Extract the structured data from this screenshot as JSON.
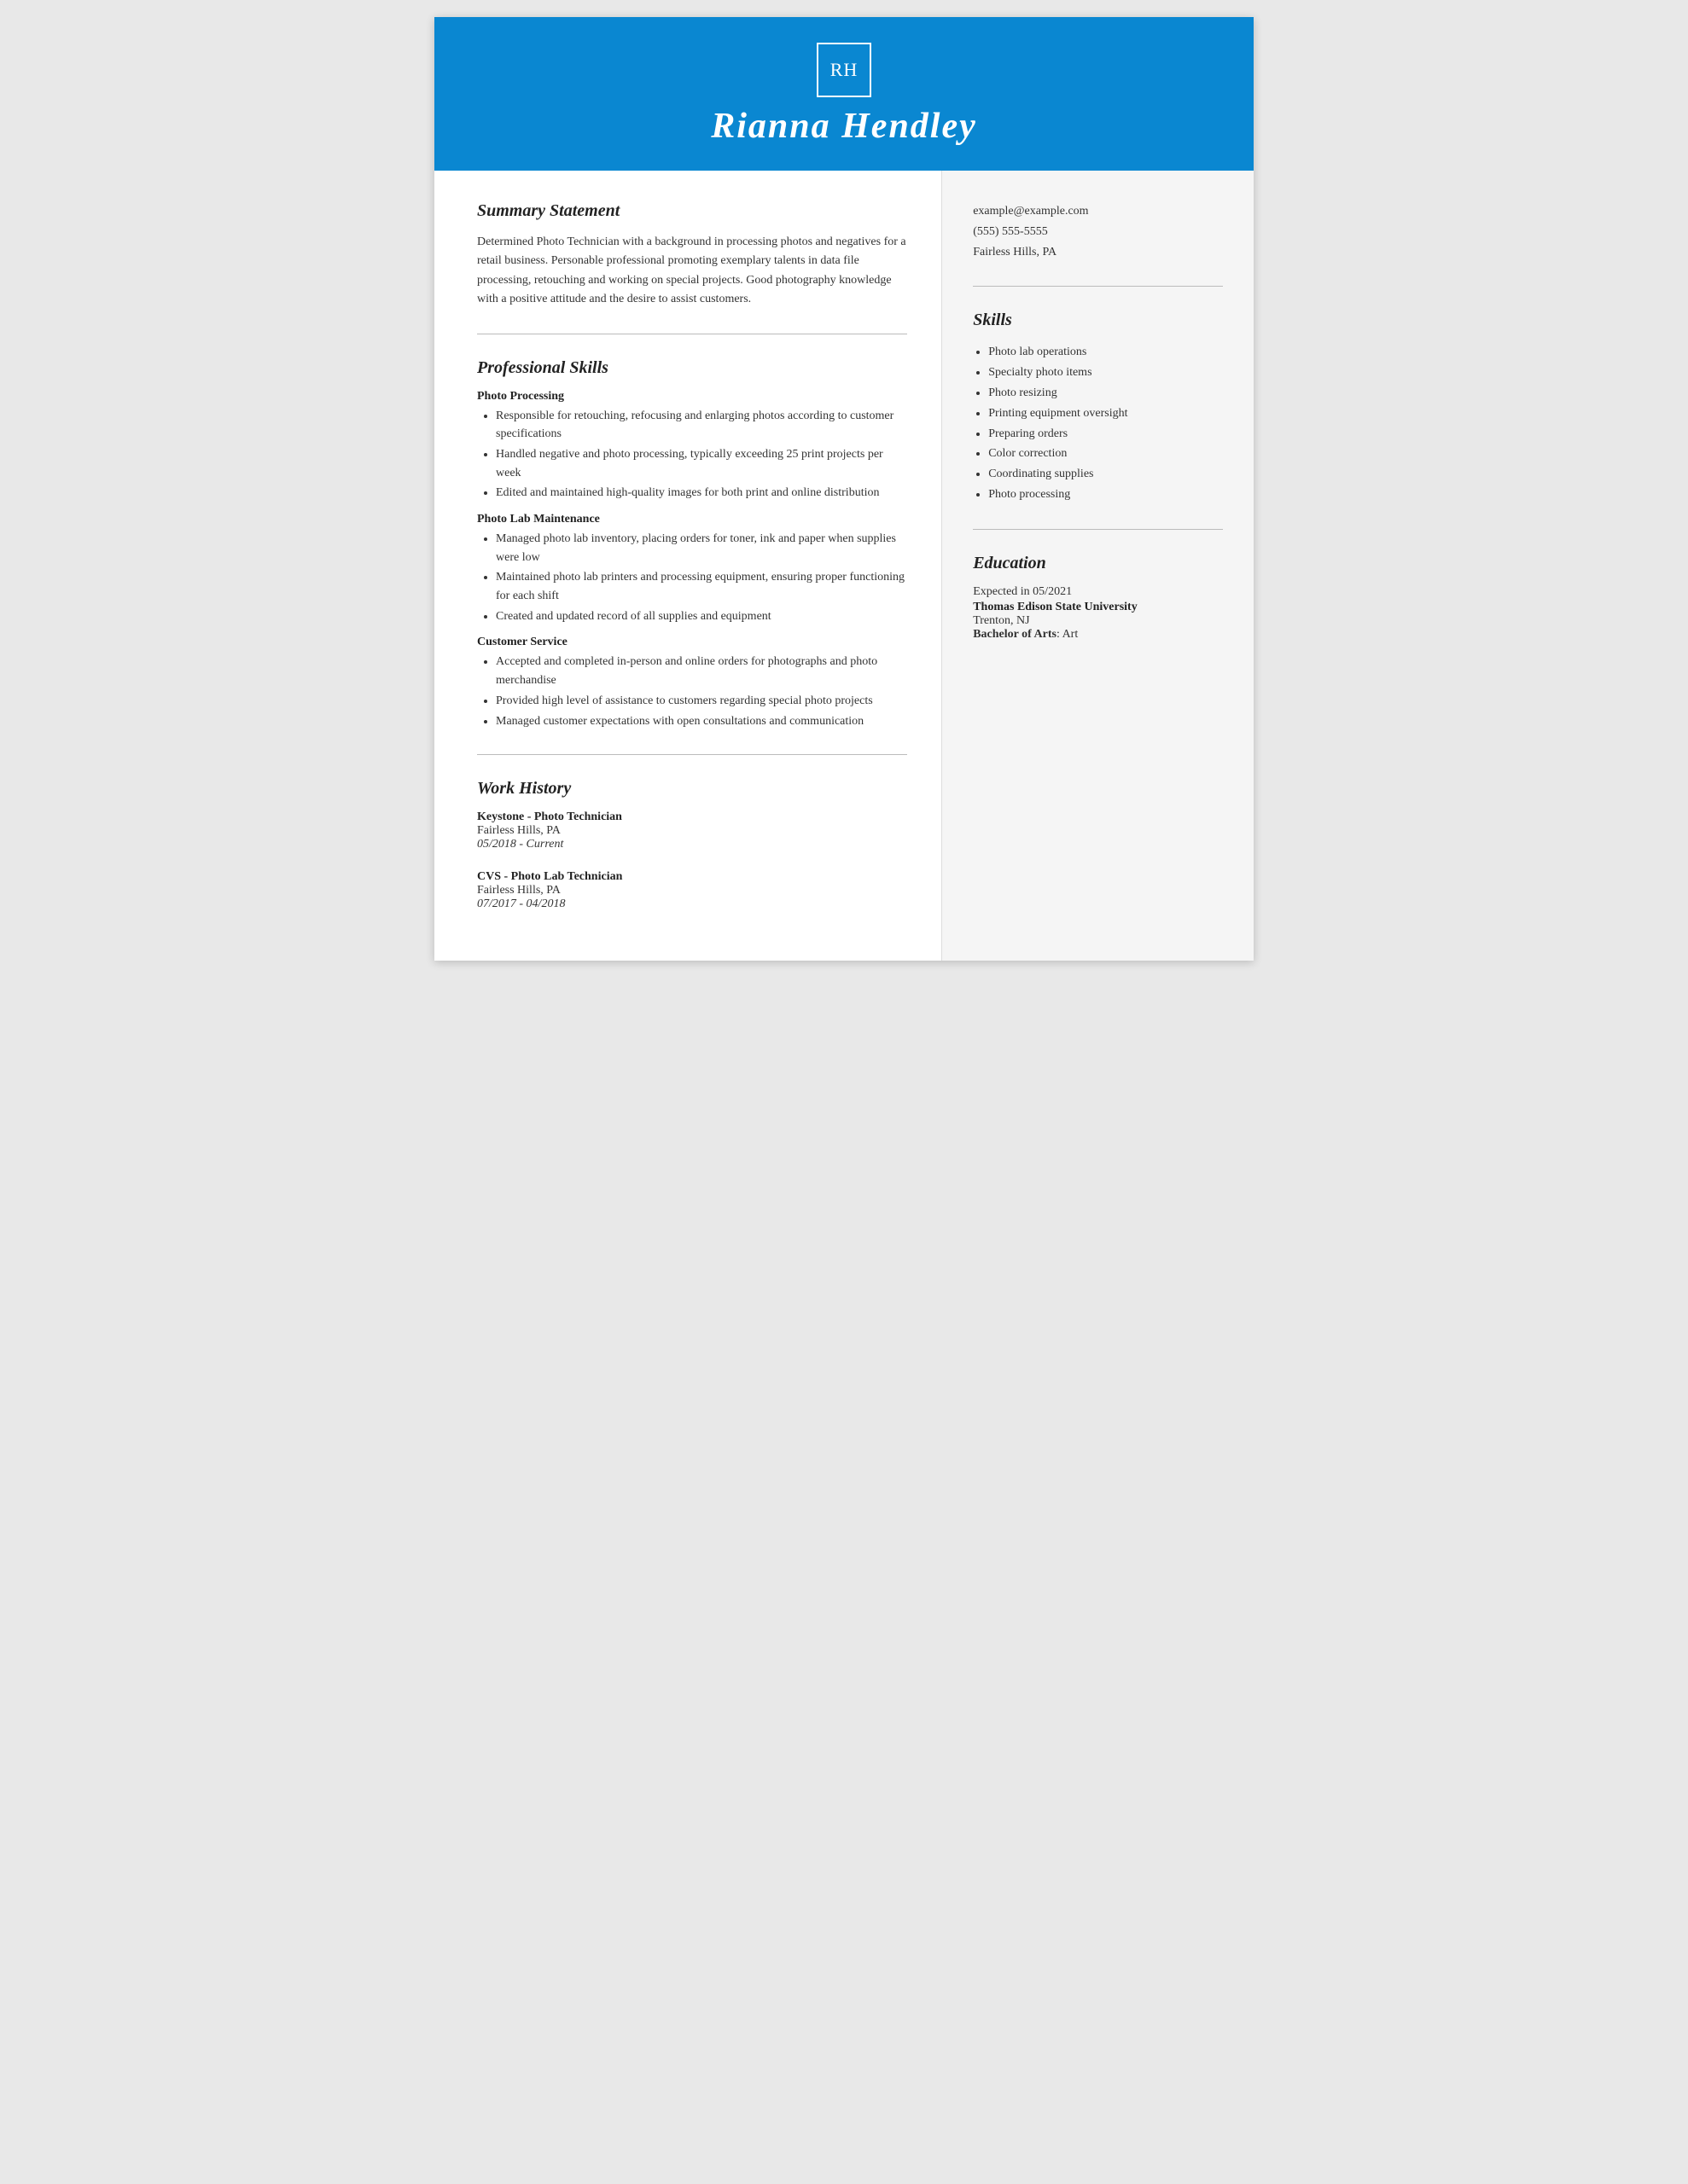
{
  "header": {
    "monogram": "RH",
    "name": "Rianna Hendley"
  },
  "contact": {
    "email": "example@example.com",
    "phone": "(555) 555-5555",
    "location": "Fairless Hills, PA"
  },
  "summary": {
    "title": "Summary Statement",
    "text": "Determined Photo Technician with a background in processing photos and negatives for a retail business. Personable professional promoting exemplary talents in data file processing, retouching and working on special projects. Good photography knowledge with a positive attitude and the desire to assist customers."
  },
  "professional_skills": {
    "title": "Professional Skills",
    "categories": [
      {
        "name": "Photo Processing",
        "items": [
          "Responsible for retouching, refocusing and enlarging photos according to customer specifications",
          "Handled negative and photo processing, typically exceeding 25 print projects per week",
          "Edited and maintained high-quality images for both print and online distribution"
        ]
      },
      {
        "name": "Photo Lab Maintenance",
        "items": [
          "Managed photo lab inventory, placing orders for toner, ink and paper when supplies were low",
          "Maintained photo lab printers and processing equipment, ensuring proper functioning for each shift",
          "Created and updated record of all supplies and equipment"
        ]
      },
      {
        "name": "Customer Service",
        "items": [
          "Accepted and completed in-person and online orders for photographs and photo merchandise",
          "Provided high level of assistance to customers regarding special photo projects",
          "Managed customer expectations with open consultations and communication"
        ]
      }
    ]
  },
  "work_history": {
    "title": "Work History",
    "jobs": [
      {
        "title": "Keystone - Photo Technician",
        "location": "Fairless Hills, PA",
        "dates": "05/2018 - Current"
      },
      {
        "title": "CVS - Photo Lab Technician",
        "location": "Fairless Hills, PA",
        "dates": "07/2017 - 04/2018"
      }
    ]
  },
  "skills": {
    "title": "Skills",
    "items": [
      "Photo lab operations",
      "Specialty photo items",
      "Photo resizing",
      "Printing equipment oversight",
      "Preparing orders",
      "Color correction",
      "Coordinating supplies",
      "Photo processing"
    ]
  },
  "education": {
    "title": "Education",
    "expected": "Expected in 05/2021",
    "school": "Thomas Edison State University",
    "location": "Trenton, NJ",
    "degree_label": "Bachelor of Arts",
    "degree_field": "Art"
  }
}
